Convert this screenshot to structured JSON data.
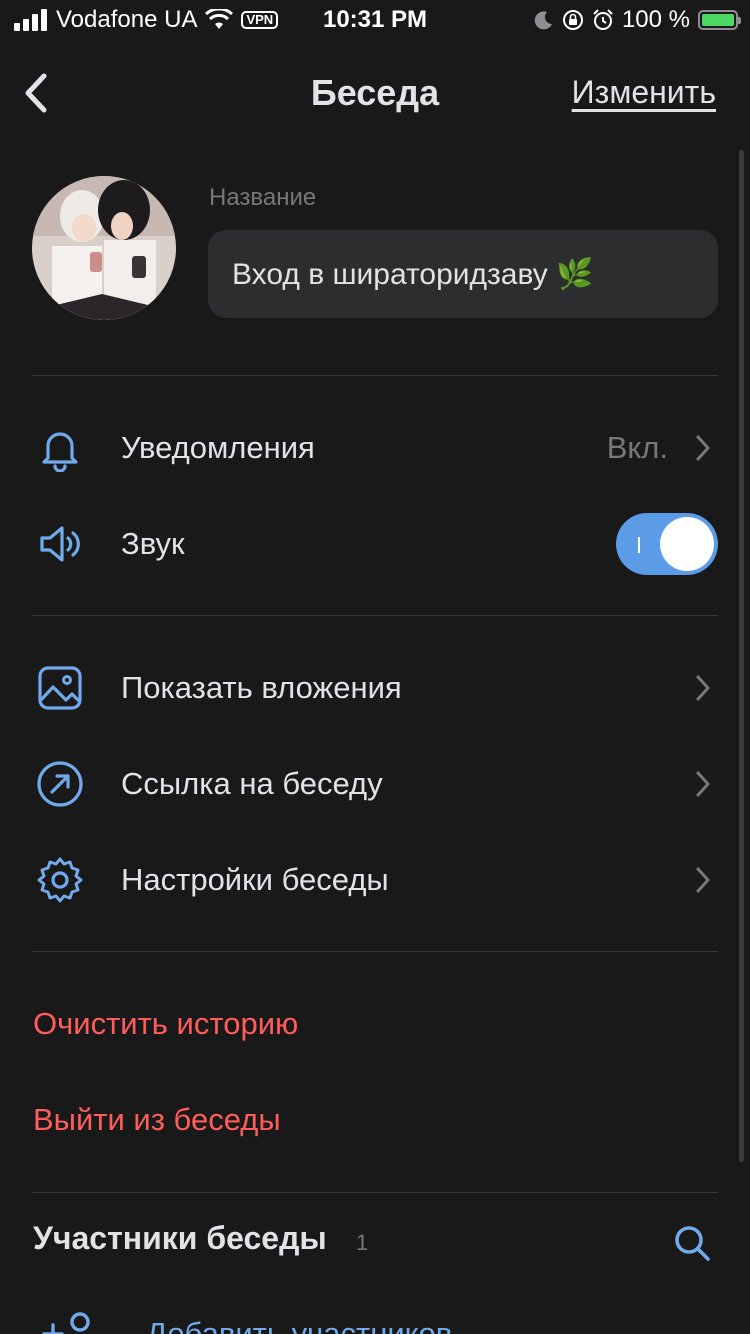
{
  "status_bar": {
    "carrier": "Vodafone UA",
    "vpn": "VPN",
    "time": "10:31 PM",
    "battery": "100 %"
  },
  "header": {
    "title": "Беседа",
    "edit": "Изменить"
  },
  "profile": {
    "name_label": "Название",
    "name_value": "Вход в ширатоpидзаву 🌿"
  },
  "rows": {
    "notifications": {
      "label": "Уведомления",
      "value": "Вкл."
    },
    "sound": {
      "label": "Звук",
      "enabled": true
    },
    "attachments": {
      "label": "Показать вложения"
    },
    "link": {
      "label": "Ссылка на беседу"
    },
    "settings": {
      "label": "Настройки беседы"
    }
  },
  "danger": {
    "clear": "Очистить историю",
    "leave": "Выйти из беседы"
  },
  "members": {
    "title": "Участники беседы",
    "count": "1",
    "add": "Добавить участников"
  },
  "colors": {
    "accent": "#71aaeb",
    "toggle": "#5c9ce6",
    "danger": "#ff5c5c",
    "background": "#19191a"
  }
}
